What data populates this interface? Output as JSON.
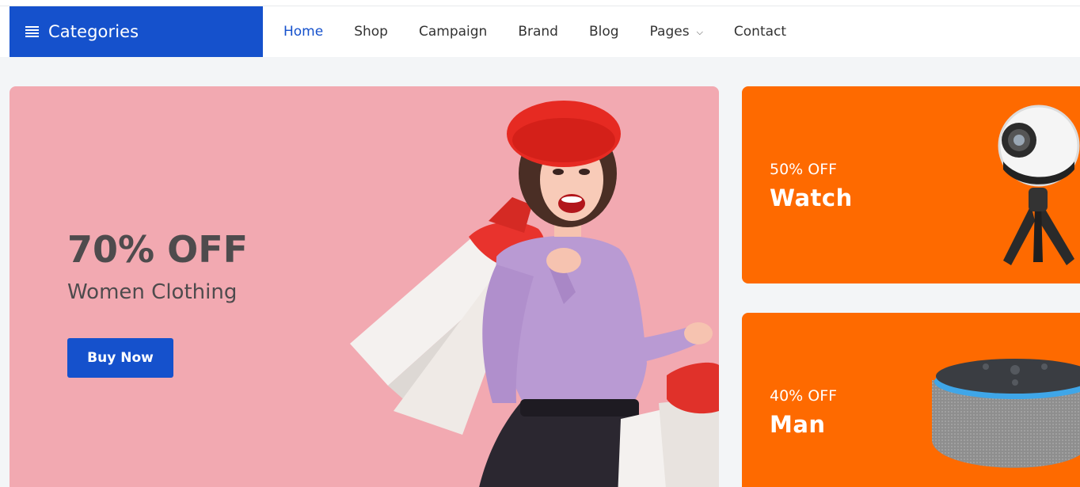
{
  "nav": {
    "categories_label": "Categories",
    "links": [
      {
        "label": "Home",
        "active": true
      },
      {
        "label": "Shop"
      },
      {
        "label": "Campaign"
      },
      {
        "label": "Brand"
      },
      {
        "label": "Blog"
      },
      {
        "label": "Pages",
        "has_dropdown": true
      },
      {
        "label": "Contact"
      }
    ]
  },
  "hero": {
    "discount": "70% OFF",
    "subtitle": "Women Clothing",
    "button_label": "Buy Now"
  },
  "promos": [
    {
      "discount": "50% OFF",
      "name": "Watch"
    },
    {
      "discount": "40% OFF",
      "name": "Man"
    }
  ],
  "colors": {
    "brand_blue": "#1551cc",
    "hero_pink": "#f2a9b1",
    "promo_orange": "#fe6a00"
  }
}
